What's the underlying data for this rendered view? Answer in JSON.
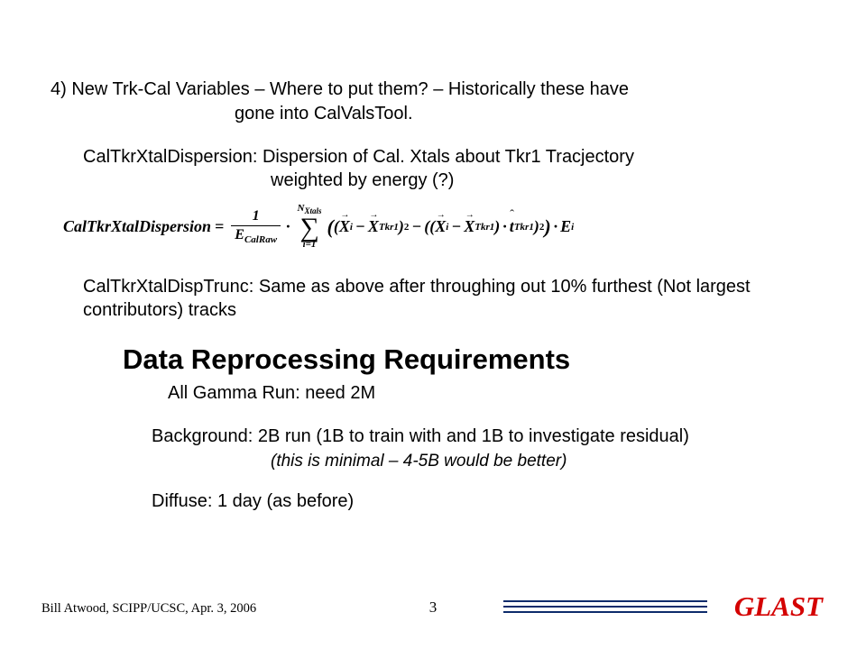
{
  "point4": {
    "line1": "4)  New Trk-Cal Variables – Where to put them? – Historically these have",
    "line2": "gone into CalValsTool."
  },
  "var1": {
    "line1": "CalTkrXtalDispersion:   Dispersion of Cal. Xtals about Tkr1 Tracjectory",
    "line2": "weighted by energy (?)"
  },
  "formula": {
    "lhs": "CalTkrXtalDispersion",
    "eq": "=",
    "frac_num": "1",
    "frac_den_E": "E",
    "frac_den_sub": "CalRaw",
    "dot": "·",
    "sigma_top_N": "N",
    "sigma_top_sub": "Xtals",
    "sigma": "∑",
    "sigma_bot": "i=1",
    "open1": "(",
    "open2": "(",
    "Xi": "X",
    "Xi_sub": "i",
    "minus1": "−",
    "Xtkr": "X",
    "Xtkr_sub": "Tkr1",
    "close2": ")",
    "sq1": "2",
    "minus2": "−",
    "open3": "(",
    "open4": "(",
    "Xi2": "X",
    "Xi2_sub": "i",
    "minus3": "−",
    "Xtkr2": "X",
    "Xtkr2_sub": "Tkr1",
    "close4": ")",
    "dot2": "·",
    "t": "t",
    "t_sub": "Tkr1",
    "close3": ")",
    "sq2": "2",
    "close1": ")",
    "dot3": "·",
    "Ei": "E",
    "Ei_sub": "i"
  },
  "var2": "CalTkrXtalDispTrunc: Same as above after throughing out 10% furthest (Not largest contributors) tracks",
  "section_title": "Data Reprocessing Requirements",
  "all_gamma": "All Gamma Run: need 2M",
  "background": "Background:  2B run (1B to train with and 1B to investigate residual)",
  "background_note": "(this is minimal – 4-5B would be better)",
  "diffuse": "Diffuse: 1 day (as before)",
  "footer": {
    "author": "Bill Atwood, SCIPP/UCSC,  Apr. 3, 2006",
    "page": "3",
    "brand": "GLAST"
  }
}
